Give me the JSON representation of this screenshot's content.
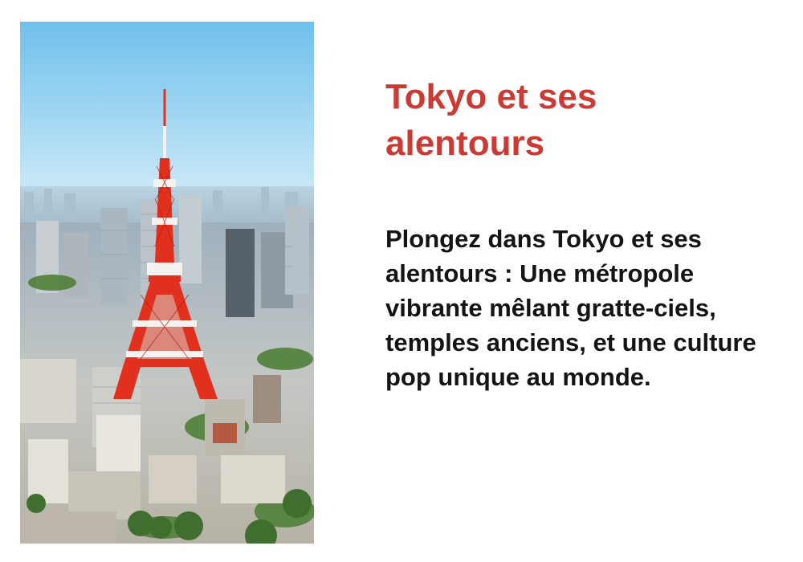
{
  "card": {
    "title": "Tokyo et ses alentours",
    "description": "Plongez dans Tokyo et ses alentours : Une métropole vibrante mêlant gratte-ciels, temples anciens, et une culture pop unique au monde."
  },
  "colors": {
    "title": "#cc3a34",
    "body_text": "#141414",
    "sky_top": "#6fc0ec",
    "sky_bottom": "#cfeaf8",
    "tower_red": "#e2301f",
    "tower_white": "#f4f2ee"
  },
  "photo": {
    "subject": "tokyo-tower-skyline"
  }
}
